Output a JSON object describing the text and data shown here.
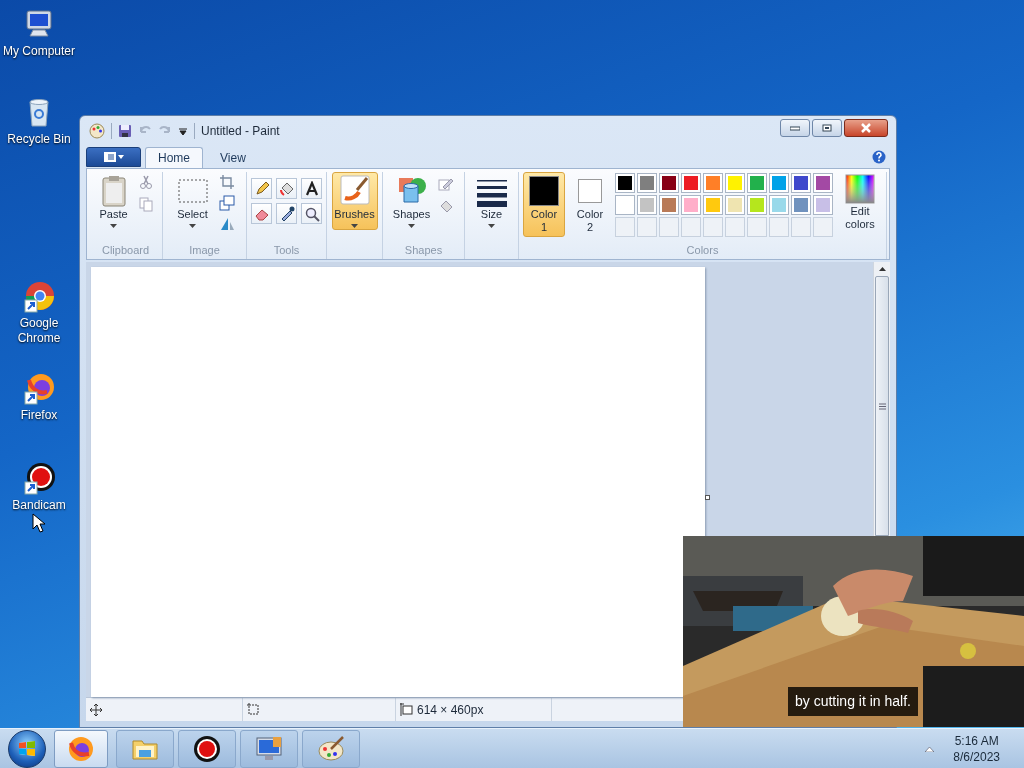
{
  "desktop_icons": [
    {
      "kind": "computer",
      "label": "My Computer"
    },
    {
      "kind": "bin",
      "label": "Recycle Bin"
    },
    {
      "kind": "chrome",
      "label": "Google Chrome"
    },
    {
      "kind": "firefox",
      "label": "Firefox"
    },
    {
      "kind": "bandicam",
      "label": "Bandicam"
    }
  ],
  "window": {
    "title": "Untitled - Paint",
    "tabs": [
      {
        "label": "Home",
        "selected": true
      },
      {
        "label": "View",
        "selected": false
      }
    ],
    "ribbon": {
      "groups": [
        {
          "kind": "clipboard",
          "label": "Clipboard",
          "button": "Paste"
        },
        {
          "label": "Image",
          "button": "Select"
        },
        {
          "kind": "tools",
          "label": "Tools"
        },
        {
          "kind": "brushes",
          "button": "Brushes",
          "selected": true
        },
        {
          "kind": "shapes",
          "label": "Shapes",
          "button": "Shapes"
        },
        {
          "kind": "size",
          "button": "Size"
        },
        {
          "kind": "colors",
          "label": "Colors",
          "current_colors": [
            {
              "label": "Color 1",
              "color": "#000000",
              "selected": true
            },
            {
              "label": "Color 2",
              "color": "#ffffff",
              "selected": false
            }
          ],
          "edit": "Edit colors",
          "palette": [
            {
              "color": "#000000"
            },
            {
              "color": "#7f7f7f"
            },
            {
              "color": "#880015"
            },
            {
              "color": "#ed1c24"
            },
            {
              "color": "#ff7f27"
            },
            {
              "color": "#fff200"
            },
            {
              "color": "#22b14c"
            },
            {
              "color": "#00a2e8"
            },
            {
              "color": "#3f48cc"
            },
            {
              "color": "#a349a4"
            },
            {
              "color": "#ffffff"
            },
            {
              "color": "#c3c3c3"
            },
            {
              "color": "#b97a57"
            },
            {
              "color": "#ffaec9"
            },
            {
              "color": "#ffc90e"
            },
            {
              "color": "#efe4b0"
            },
            {
              "color": "#b5e61d"
            },
            {
              "color": "#99d9ea"
            },
            {
              "color": "#7092be"
            },
            {
              "color": "#c8bfe7"
            }
          ]
        }
      ]
    },
    "status_bar": {
      "dimensions": "614 × 460px"
    }
  },
  "video": {
    "kind": "picture",
    "caption": "by cutting it in half."
  },
  "taskbar": {
    "items": [
      {
        "kind": "firefox",
        "selected": true
      },
      {
        "kind": "explorer",
        "selected": false
      },
      {
        "kind": "bandicam",
        "selected": false
      },
      {
        "kind": "computer",
        "selected": false
      },
      {
        "kind": "paint",
        "selected": false
      }
    ],
    "time": "5:16 AM",
    "date": "8/6/2023"
  }
}
